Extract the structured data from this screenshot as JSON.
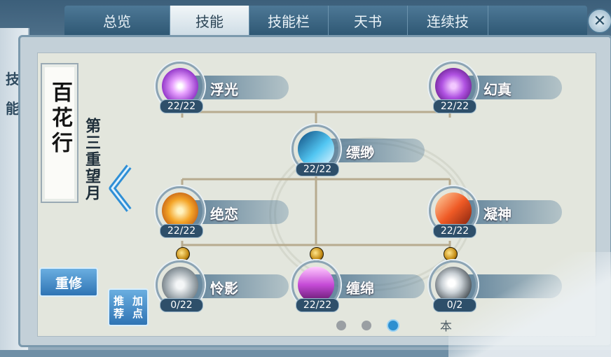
{
  "tabs": [
    {
      "label": "总览"
    },
    {
      "label": "技能"
    },
    {
      "label": "技能栏"
    },
    {
      "label": "天书"
    },
    {
      "label": "连续技"
    }
  ],
  "active_tab": "技能",
  "close_label": "✕",
  "side_label": "技能",
  "school": {
    "name": "百花行",
    "layer": "第三重望月"
  },
  "buttons": {
    "rebuild": "重修",
    "recommend_line1": "推荐",
    "recommend_line2": "加点"
  },
  "skills": [
    {
      "name": "浮光",
      "level": "22/22",
      "color": "#b94ce8"
    },
    {
      "name": "幻真",
      "level": "22/22",
      "color": "#a53fd8"
    },
    {
      "name": "缥缈",
      "level": "22/22",
      "color": "#2f9ad8"
    },
    {
      "name": "绝恋",
      "level": "22/22",
      "color": "#f0a12a"
    },
    {
      "name": "凝神",
      "level": "22/22",
      "color": "#e2552a"
    },
    {
      "name": "怜影",
      "level": "0/22",
      "color": "#8d9aa4"
    },
    {
      "name": "缠绵",
      "level": "22/22",
      "color": "#c24ad2"
    },
    {
      "name": "",
      "level": "0/2",
      "color": "#9aa5ad"
    }
  ],
  "pager": {
    "count": 3,
    "active_index": 2
  },
  "footer_partial": "本"
}
